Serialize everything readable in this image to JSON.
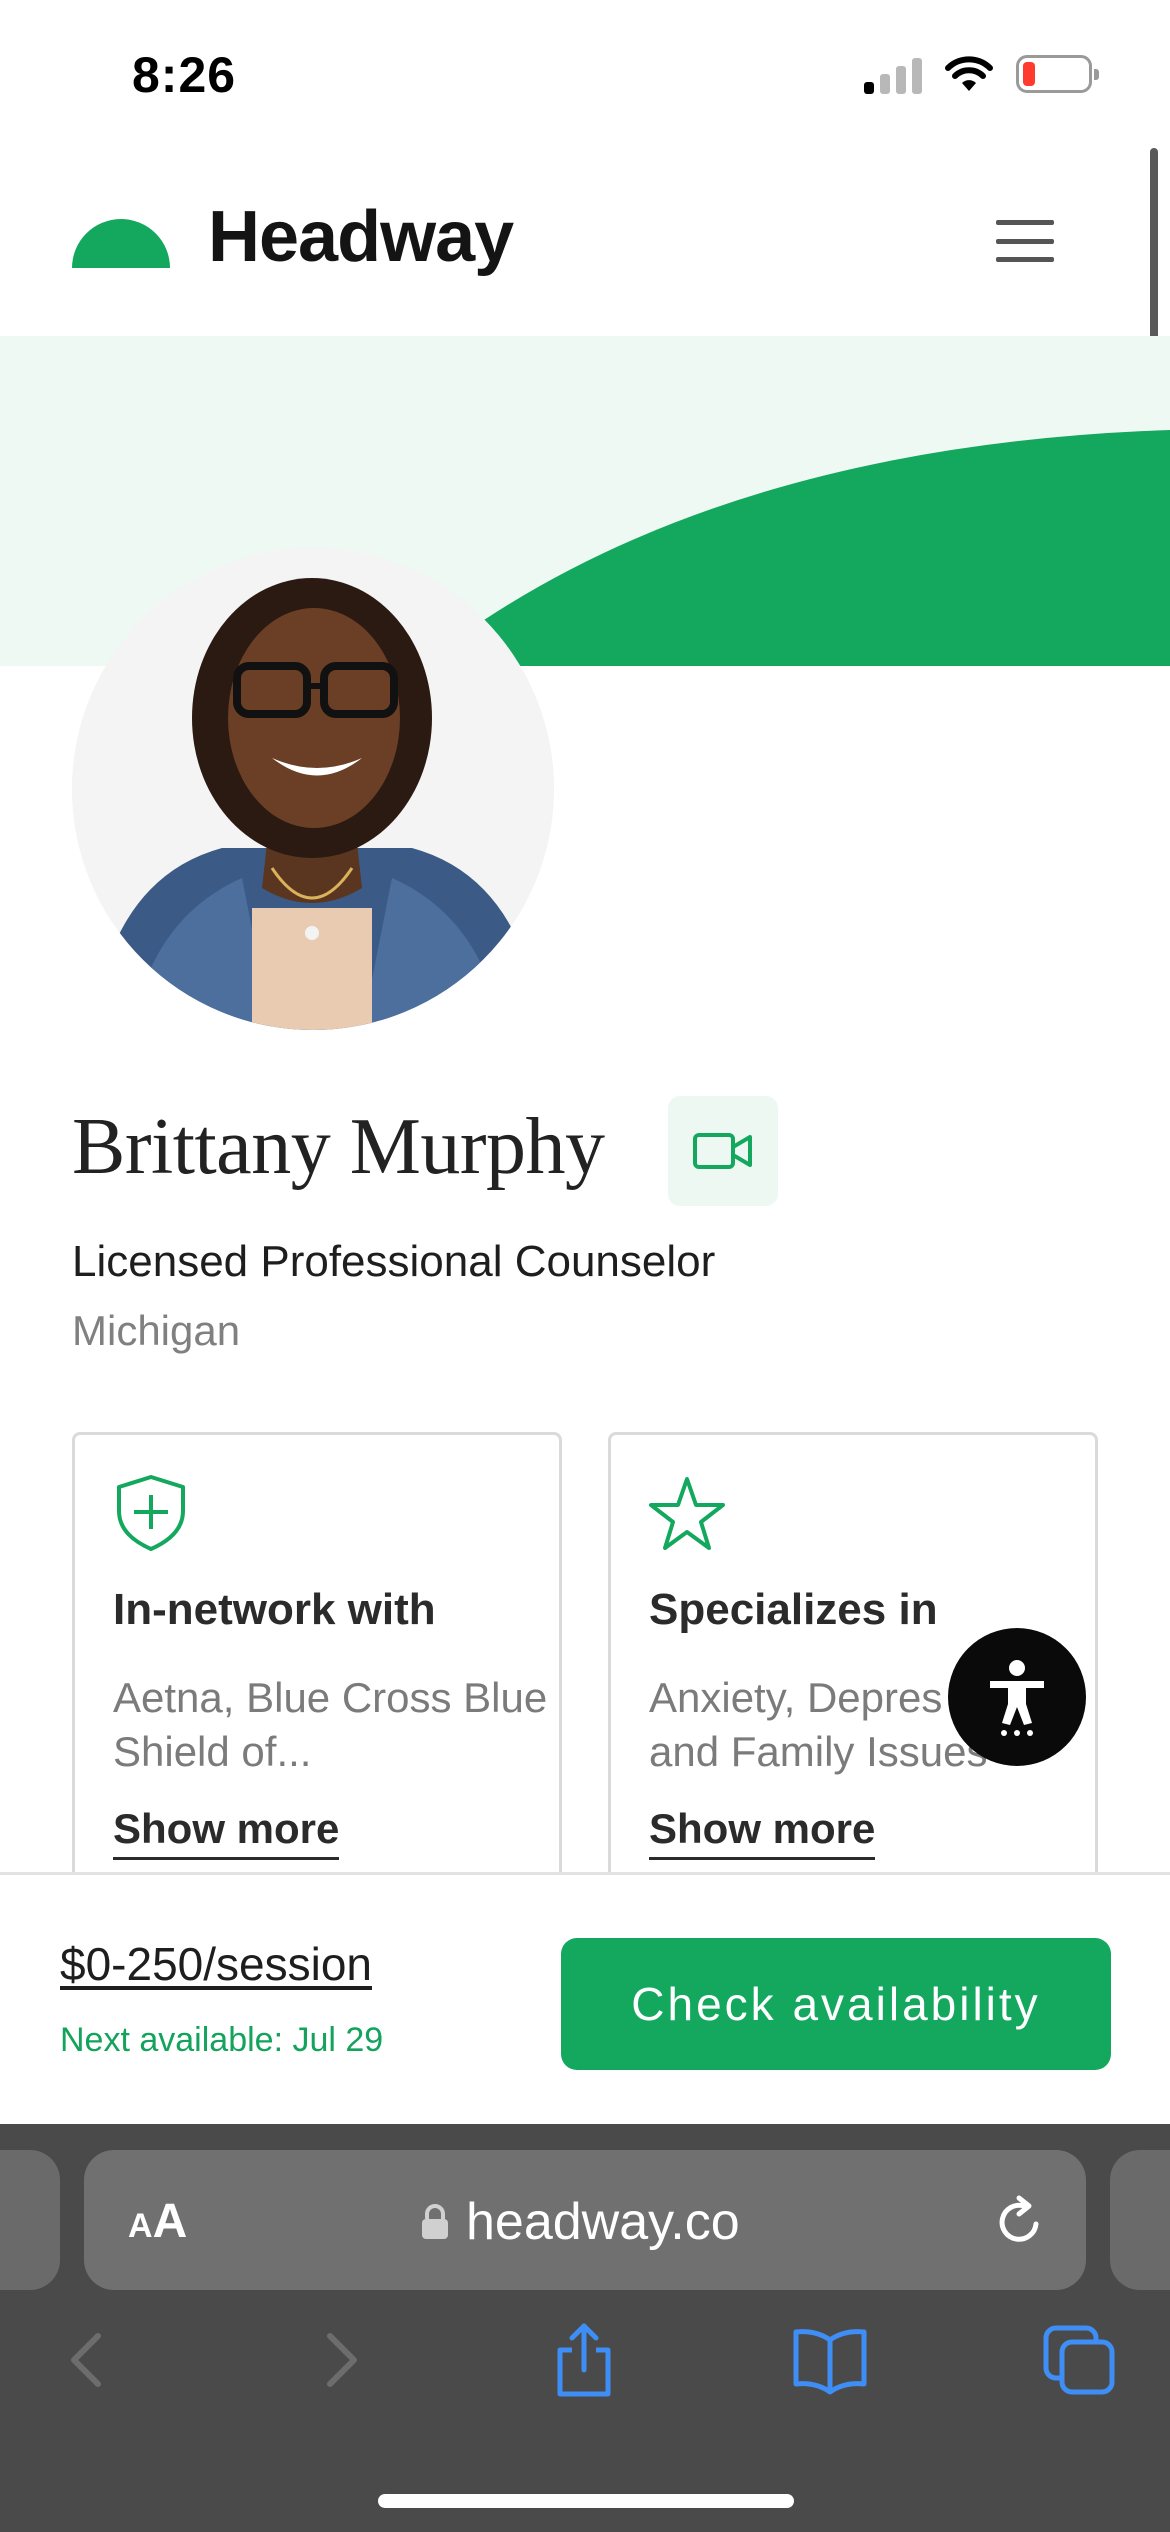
{
  "status_bar": {
    "time": "8:26"
  },
  "header": {
    "logo_text": "Headway"
  },
  "provider": {
    "name": "Brittany Murphy",
    "license": "Licensed Professional Counselor",
    "location": "Michigan"
  },
  "cards": [
    {
      "title": "In-network with",
      "body": "Aetna, Blue Cross Blue Shield of...",
      "link": "Show more",
      "icon": "shield-plus-icon"
    },
    {
      "title": "Specializes in",
      "body_line1": "Anxiety, Depres",
      "body_line2": "and Family Issues",
      "link": "Show more",
      "icon": "star-icon"
    }
  ],
  "booking": {
    "price": "$0-250/session",
    "next_available": "Next available: Jul 29",
    "cta_label": "Check availability"
  },
  "browser": {
    "text_size_label_small": "A",
    "text_size_label_large": "A",
    "url": "headway.co"
  },
  "colors": {
    "brand_green": "#14a85f",
    "hero_tint": "#eef9f4"
  }
}
